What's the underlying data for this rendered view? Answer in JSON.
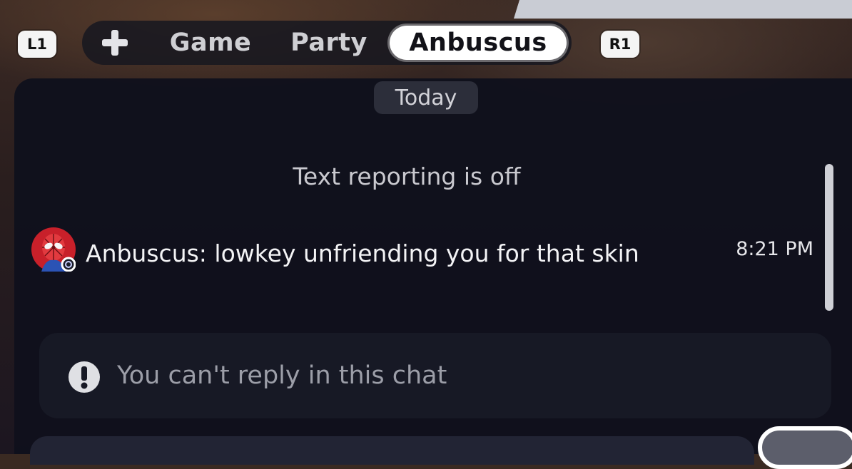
{
  "controls": {
    "left_bumper": "L1",
    "right_bumper": "R1"
  },
  "tabs": {
    "add_icon": "plus-icon",
    "items": [
      {
        "label": "Game"
      },
      {
        "label": "Party"
      },
      {
        "label": "Anbuscus",
        "active": true
      }
    ]
  },
  "chat": {
    "date_label": "Today",
    "notice": "Text reporting is off",
    "messages": [
      {
        "avatar_icon": "spider-man-avatar-icon",
        "text": "Anbuscus: lowkey unfriending you for that skin",
        "time": "8:21 PM"
      }
    ],
    "reply_status": "You can't reply in this chat",
    "reply_icon": "exclamation-circle-icon"
  },
  "colors": {
    "panel": "#10111c",
    "active_tab": "#ffffff",
    "avatar_red": "#d2232a"
  }
}
